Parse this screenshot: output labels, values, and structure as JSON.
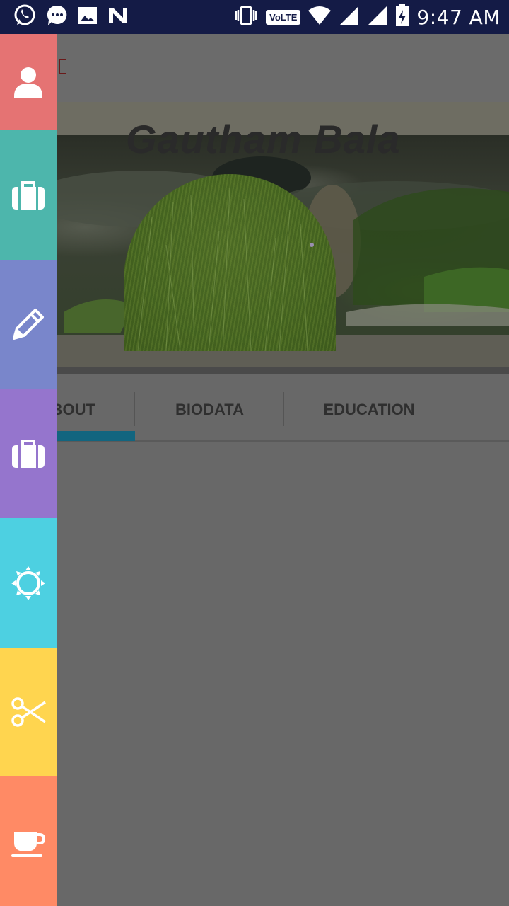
{
  "status_bar": {
    "time": "9:47 AM",
    "network_badge": "VoLTE",
    "icons": [
      "whatsapp-icon",
      "message-icon",
      "gallery-icon",
      "n-app-icon",
      "vibrate-icon",
      "wifi-icon",
      "signal-icon",
      "signal-icon",
      "battery-charging-icon"
    ]
  },
  "profile": {
    "name": "Gautham Bala"
  },
  "tabs": [
    {
      "label": "BOUT",
      "active": true
    },
    {
      "label": "BIODATA",
      "active": false
    },
    {
      "label": "EDUCATION",
      "active": false
    }
  ],
  "side_menu": {
    "items": [
      {
        "icon": "user-icon",
        "color": "#e57373"
      },
      {
        "icon": "briefcase-icon",
        "color": "#4db6ac"
      },
      {
        "icon": "pencil-icon",
        "color": "#7986cb"
      },
      {
        "icon": "briefcase-icon",
        "color": "#9575cd"
      },
      {
        "icon": "sun-icon",
        "color": "#4dd0e1"
      },
      {
        "icon": "scissors-icon",
        "color": "#ffd54f"
      },
      {
        "icon": "coffee-cup-icon",
        "color": "#ff8a65"
      }
    ]
  }
}
